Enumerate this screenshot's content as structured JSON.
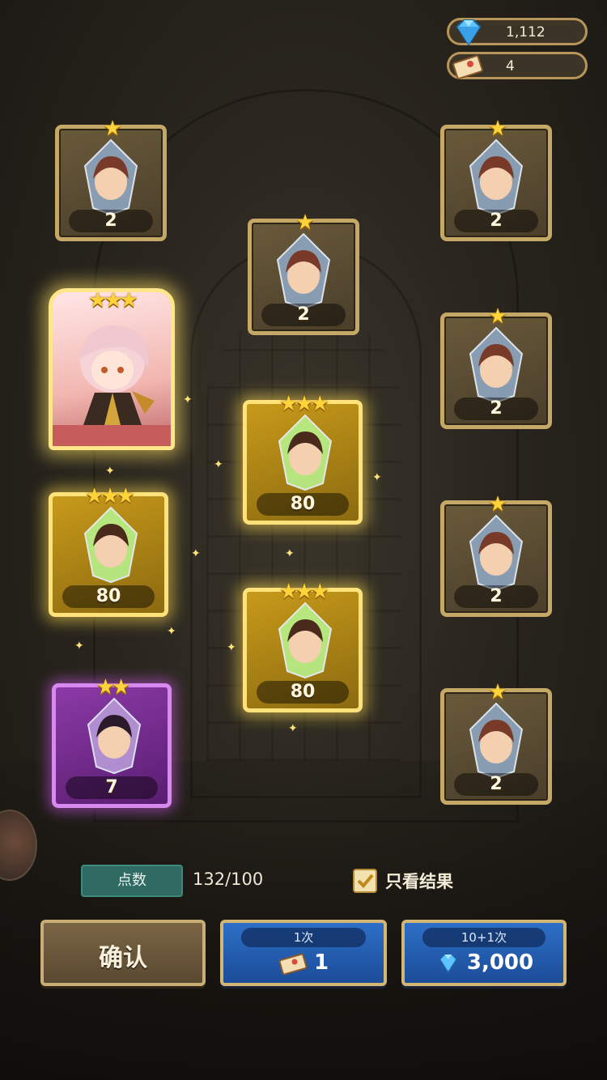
{
  "currency": {
    "gems": "1,112",
    "tickets": "4"
  },
  "cards": [
    {
      "count": "2",
      "stars": "★",
      "frame": "normal",
      "gem_color": "#8ea6c0"
    },
    {
      "count": "2",
      "stars": "★",
      "frame": "normal",
      "gem_color": "#8ea6c0"
    },
    {
      "count": "2",
      "stars": "★",
      "frame": "normal",
      "gem_color": "#8ea6c0"
    },
    {
      "count": "2",
      "stars": "★",
      "frame": "normal",
      "gem_color": "#8ea6c0"
    },
    {
      "count": "80",
      "stars": "★★★",
      "frame": "gold",
      "gem_color": "#b8f08a"
    },
    {
      "count": "80",
      "stars": "★★★",
      "frame": "gold",
      "gem_color": "#b8f08a"
    },
    {
      "count": "2",
      "stars": "★",
      "frame": "normal",
      "gem_color": "#8ea6c0"
    },
    {
      "count": "80",
      "stars": "★★★",
      "frame": "gold",
      "gem_color": "#b8f08a"
    },
    {
      "count": "7",
      "stars": "★★",
      "frame": "purple",
      "gem_color": "#b899d8"
    },
    {
      "count": "2",
      "stars": "★",
      "frame": "normal",
      "gem_color": "#8ea6c0"
    }
  ],
  "hero": {
    "stars": "★★★"
  },
  "bottom": {
    "points_label": "点数",
    "points_value": "132/100",
    "only_results_label": "只看结果",
    "confirm_label": "确认",
    "single_pull_top": "1次",
    "single_pull_cost": "1",
    "multi_pull_top": "10+1次",
    "multi_pull_cost": "3,000"
  }
}
